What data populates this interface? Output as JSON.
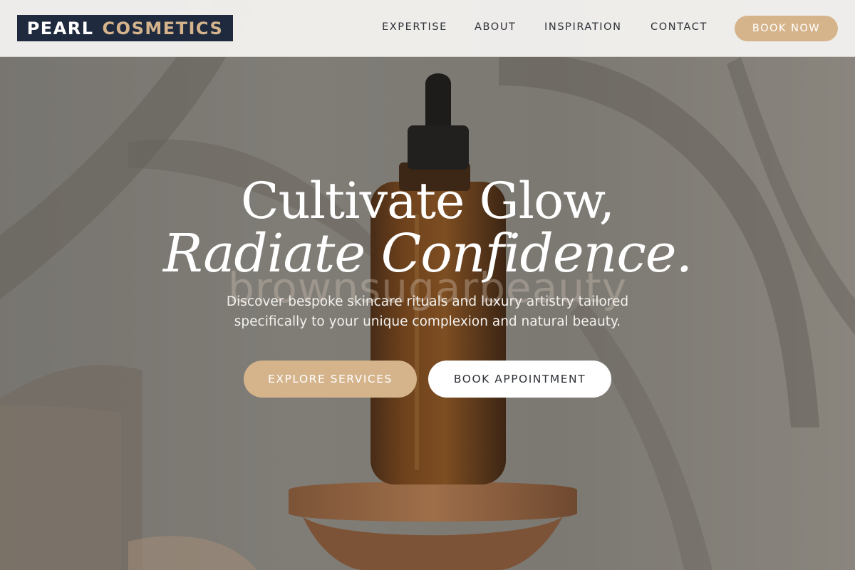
{
  "header": {
    "logo": {
      "word1": "PEARL",
      "word2": "COSMETICS"
    },
    "nav": [
      {
        "label": "EXPERTISE"
      },
      {
        "label": "ABOUT"
      },
      {
        "label": "INSPIRATION"
      },
      {
        "label": "CONTACT"
      }
    ],
    "cta_label": "BOOK NOW"
  },
  "hero": {
    "headline_line1": "Cultivate Glow,",
    "headline_line2": "Radiate Confidence.",
    "watermark": "brownsugarbeauty",
    "subtext_line1": "Discover bespoke skincare rituals and luxury artistry tailored",
    "subtext_line2": "specifically to your unique complexion and natural beauty.",
    "primary_button": "EXPLORE SERVICES",
    "secondary_button": "BOOK APPOINTMENT"
  },
  "colors": {
    "accent": "#d5b48c",
    "logo_bg": "#1f2a3f",
    "text_dark": "#2e3138"
  }
}
